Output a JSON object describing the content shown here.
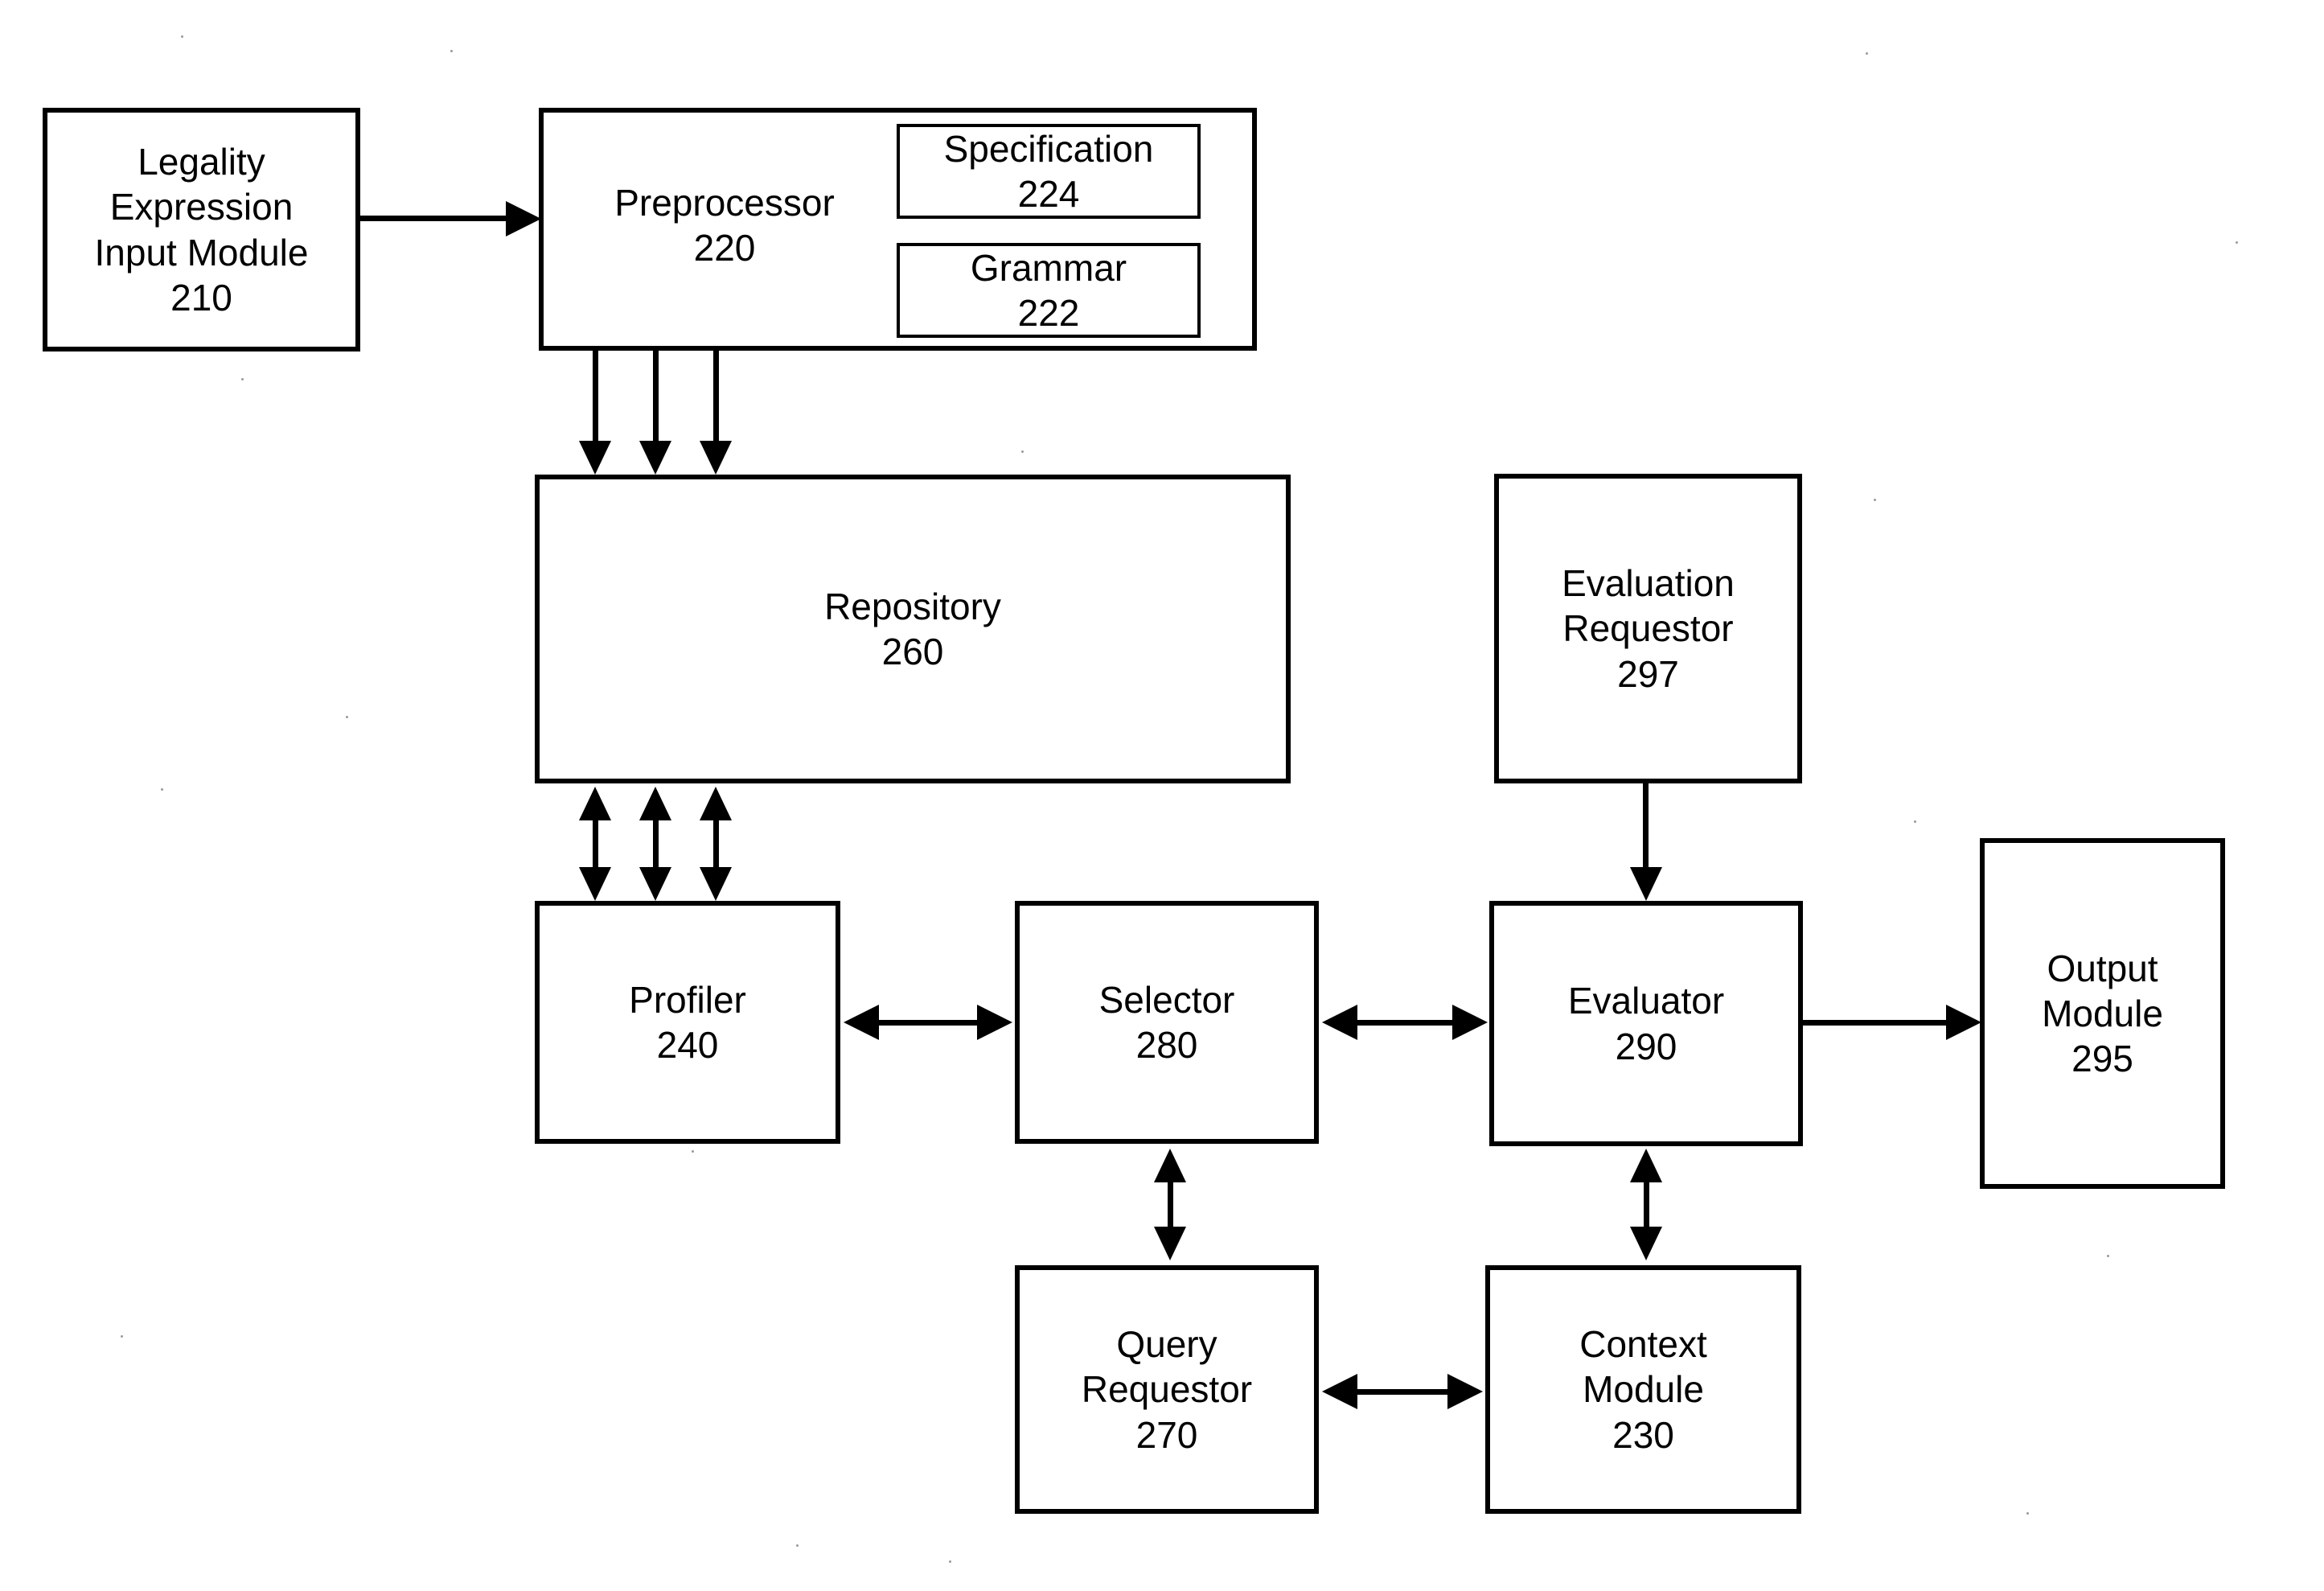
{
  "diagram": {
    "type": "block-diagram",
    "background": "#ffffff",
    "line_color": "#000000",
    "nodes": [
      {
        "id": "210",
        "label": "Legality\nExpression\nInput Module",
        "number": "210"
      },
      {
        "id": "220",
        "label": "Preprocessor",
        "number": "220"
      },
      {
        "id": "224",
        "label": "Specification",
        "number": "224"
      },
      {
        "id": "222",
        "label": "Grammar",
        "number": "222"
      },
      {
        "id": "260",
        "label": "Repository",
        "number": "260"
      },
      {
        "id": "297",
        "label": "Evaluation\nRequestor",
        "number": "297"
      },
      {
        "id": "240",
        "label": "Profiler",
        "number": "240"
      },
      {
        "id": "280",
        "label": "Selector",
        "number": "280"
      },
      {
        "id": "290",
        "label": "Evaluator",
        "number": "290"
      },
      {
        "id": "295",
        "label": "Output\nModule",
        "number": "295"
      },
      {
        "id": "270",
        "label": "Query\nRequestor",
        "number": "270"
      },
      {
        "id": "230",
        "label": "Context\nModule",
        "number": "230"
      }
    ],
    "edges": [
      {
        "from": "210",
        "to": "220",
        "direction": "one-way",
        "orientation": "horizontal"
      },
      {
        "from": "220",
        "to": "260",
        "direction": "one-way",
        "orientation": "vertical",
        "count": 3
      },
      {
        "from": "260",
        "to": "240",
        "direction": "two-way",
        "orientation": "vertical",
        "count": 3
      },
      {
        "from": "240",
        "to": "280",
        "direction": "two-way",
        "orientation": "horizontal"
      },
      {
        "from": "280",
        "to": "290",
        "direction": "two-way",
        "orientation": "horizontal"
      },
      {
        "from": "290",
        "to": "295",
        "direction": "one-way",
        "orientation": "horizontal"
      },
      {
        "from": "297",
        "to": "290",
        "direction": "one-way",
        "orientation": "vertical"
      },
      {
        "from": "280",
        "to": "270",
        "direction": "two-way",
        "orientation": "vertical"
      },
      {
        "from": "290",
        "to": "230",
        "direction": "two-way",
        "orientation": "vertical"
      },
      {
        "from": "270",
        "to": "230",
        "direction": "two-way",
        "orientation": "horizontal"
      }
    ]
  }
}
